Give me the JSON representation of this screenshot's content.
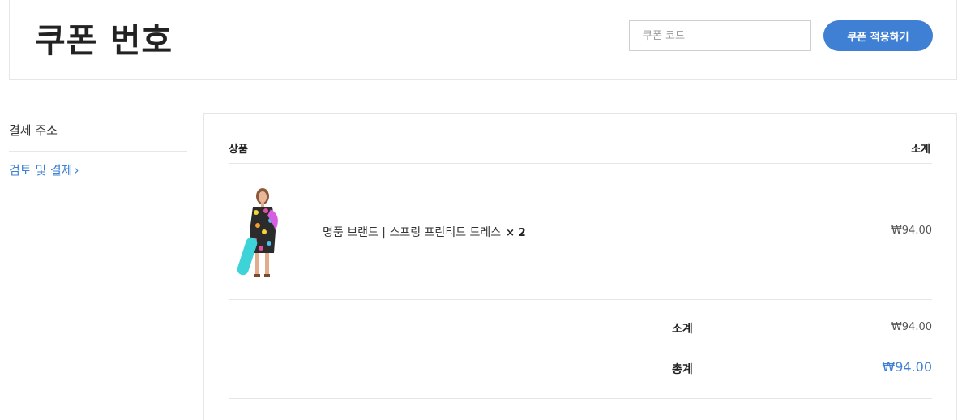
{
  "coupon": {
    "title": "쿠폰 번호",
    "input_placeholder": "쿠폰 코드",
    "input_value": "",
    "apply_label": "쿠폰 적용하기"
  },
  "steps": [
    {
      "label": "결제 주소",
      "active": false
    },
    {
      "label": "검토 및 결제",
      "active": true,
      "chevron": "›"
    }
  ],
  "order": {
    "col_product": "상품",
    "col_subtotal": "소계",
    "items": [
      {
        "name": "명품 브랜드 | 스프링 프린티드 드레스",
        "qty": "× 2",
        "price": "₩94.00",
        "image": "dress-model-photo"
      }
    ],
    "subtotal_label": "소계",
    "subtotal_value": "₩94.00",
    "total_label": "총계",
    "total_value": "₩94.00"
  },
  "colors": {
    "accent": "#3f80d5",
    "border": "#e6e6e6"
  }
}
